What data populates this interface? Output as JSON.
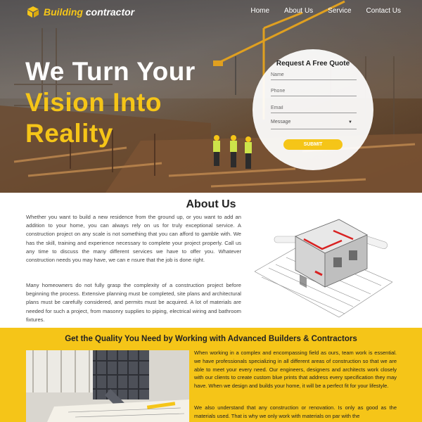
{
  "brand": {
    "name_accent": "Building",
    "name_rest": " contractor"
  },
  "nav": {
    "items": [
      "Home",
      "About Us",
      "Service",
      "Contact Us"
    ]
  },
  "hero": {
    "line1": "We Turn Your",
    "line2": "Vision Into",
    "line3": "Reality"
  },
  "quote_form": {
    "title": "Request A Free Quote",
    "name_placeholder": "Name",
    "phone_placeholder": "Phone",
    "email_placeholder": "Email",
    "message_placeholder": "Message",
    "submit_label": "SUBMIT"
  },
  "about": {
    "title": "About Us",
    "p1": "Whether you want to build a new residence from the ground up, or you want to add an addition to your home, you can always rely on us for truly exceptional service. A construction project on any scale is not something that you can afford to gamble with. We has the skill, training and experience necessary to complete your project properly. Call us any time to discuss the many different services we have to offer you. Whatever construction needs you may have, we can e nsure that the job is done right.",
    "p2": "Many homeowners do not fully grasp the complexity of a construction project before beginning the process. Extensive planning must be completed, site plans and architectural plans must be carefully considered, and permits must be acquired. A lot of materials are needed for such a project, from masonry supplies to piping, electrical wiring and bathroom fixtures."
  },
  "quality": {
    "title": "Get the Quality You Need by Working with Advanced Builders & Contractors",
    "p1": "When working in a complex and encompassing field as ours, team work is essential. we have professionals specializing in all different areas of construction so that we are able to meet your every need. Our engineers, designers and architects work closely with our clients to create custom blue prints that address every specification they may have. When we design and builds your home, it will be a perfect fit for your lifestyle.",
    "p2": "We also understand that any construction or renovation. Is only as good as the materials used. That is why we only work with materials on par with the"
  },
  "colors": {
    "accent": "#f5c518",
    "band": "#f5c518",
    "text": "#444444"
  }
}
